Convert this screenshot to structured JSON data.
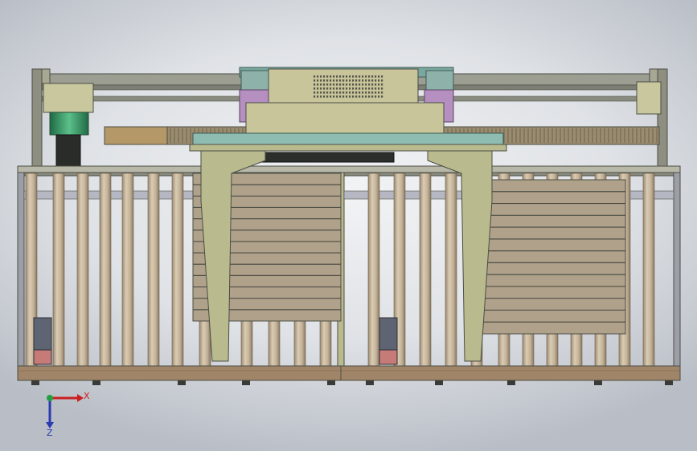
{
  "triad": {
    "x_label": "X",
    "z_label": "Z",
    "x_color": "#cc2020",
    "z_color": "#2a3ab0",
    "y_color": "#20a040"
  },
  "colors": {
    "frame": "#8e8f80",
    "frame_dark": "#55564c",
    "rack": "#9a8c6e",
    "roller": "#c5b49a",
    "gantry": "#b9bb8e",
    "housing": "#c8c59a",
    "teal": "#7aa8a0",
    "violet": "#b48fc0",
    "motor_green": "#3c9a6a",
    "base": "#a08568",
    "pallet": "#b0a28a"
  }
}
